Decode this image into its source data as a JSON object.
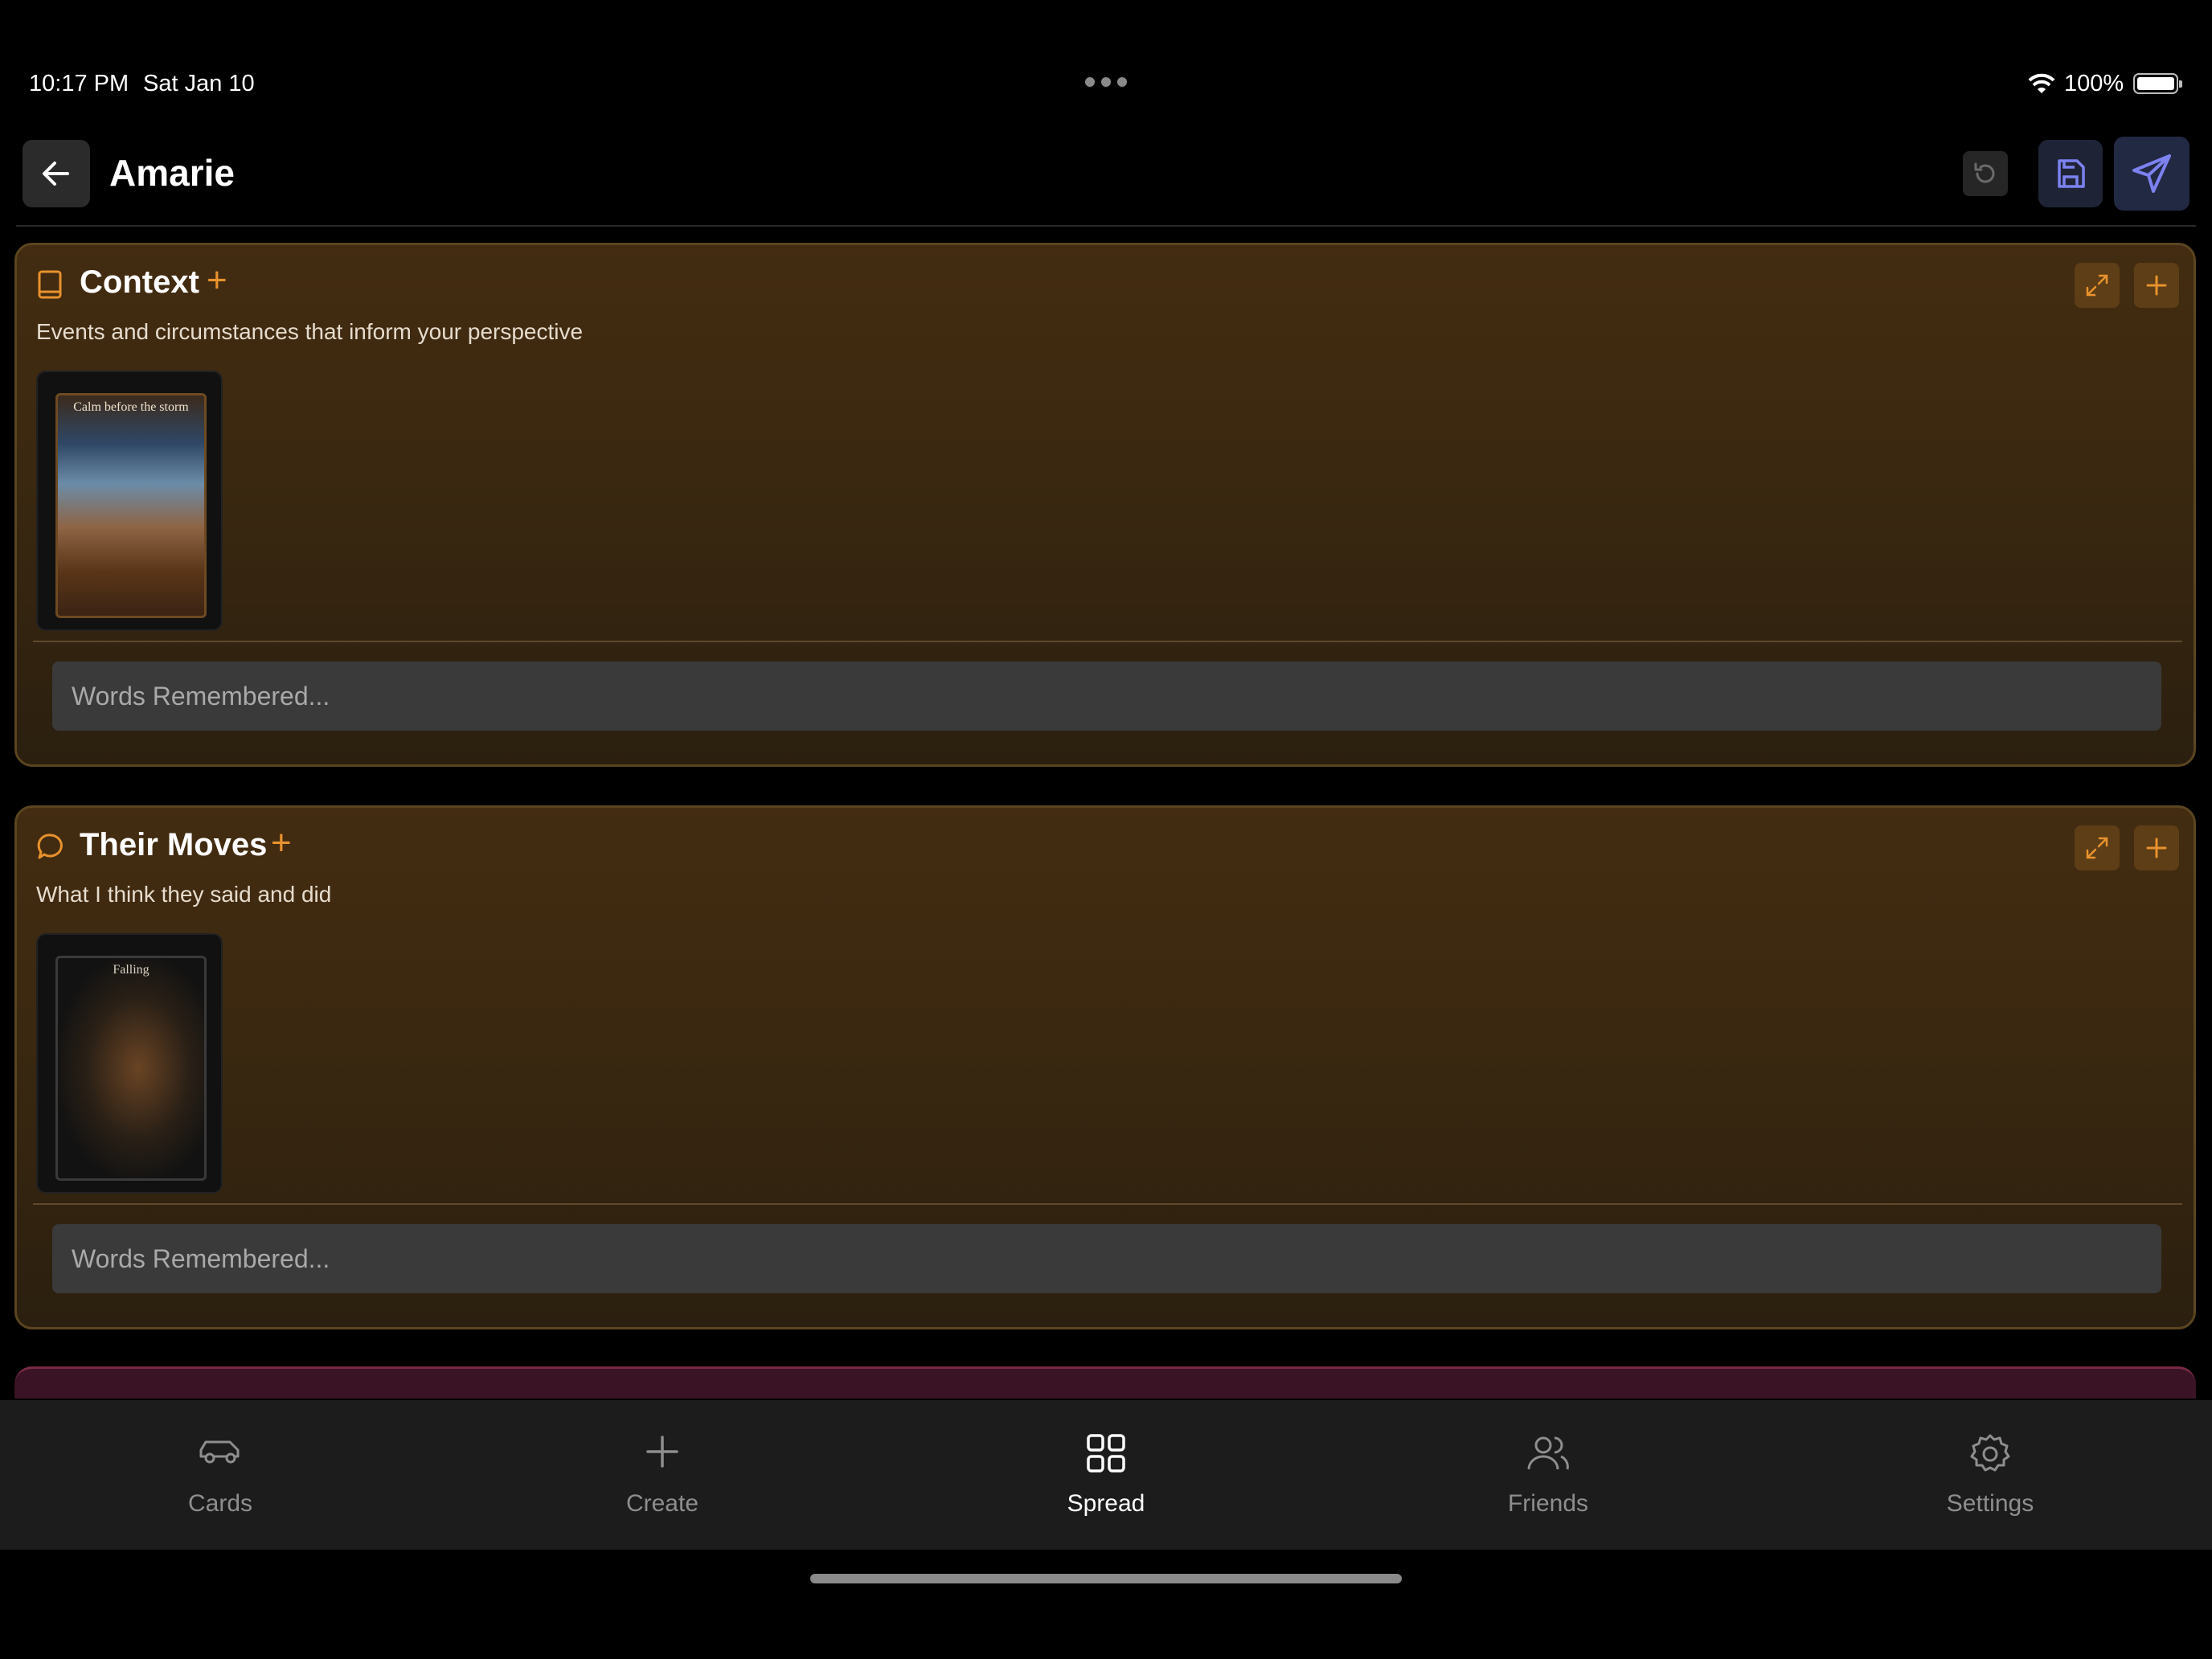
{
  "status_bar": {
    "time": "10:17 PM",
    "date": "Sat Jan 10",
    "battery": "100%"
  },
  "header": {
    "title": "Amarie"
  },
  "sections": [
    {
      "title": "Context",
      "subtitle": "Events and circumstances that inform your perspective",
      "card_title": "Calm before the storm",
      "words_placeholder": "Words Remembered...",
      "icon": "book-icon"
    },
    {
      "title": "Their Moves",
      "subtitle": "What I think they said and did",
      "card_title": "Falling",
      "words_placeholder": "Words Remembered...",
      "icon": "speech-bubble-icon"
    }
  ],
  "tabs": [
    {
      "label": "Cards",
      "icon": "car-icon"
    },
    {
      "label": "Create",
      "icon": "plus-icon"
    },
    {
      "label": "Spread",
      "icon": "grid-icon",
      "active": true
    },
    {
      "label": "Friends",
      "icon": "users-icon"
    },
    {
      "label": "Settings",
      "icon": "gear-icon"
    }
  ],
  "colors": {
    "accent": "#e8922d",
    "section_bg": "#3a2810",
    "send": "#7c82f0"
  }
}
